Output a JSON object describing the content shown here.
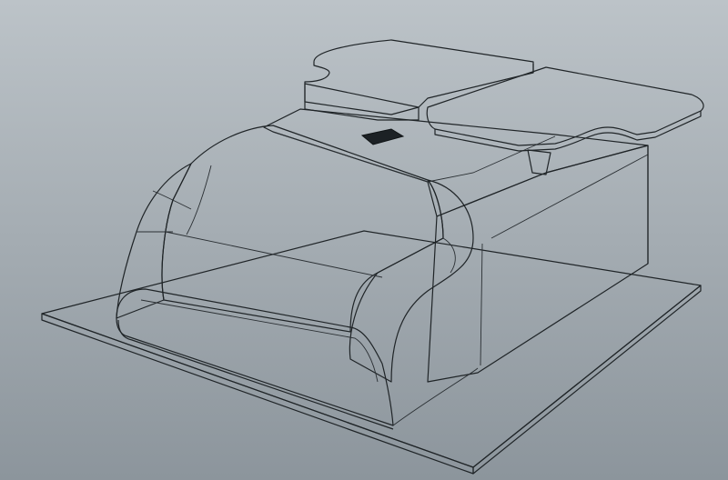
{
  "viewport": {
    "background_top": "#bcc3c8",
    "background_bottom": "#8c959c"
  },
  "model": {
    "body_color": "#4a5257",
    "base_plate_color": "#5b6368",
    "lid_color": "#9ea2a5",
    "edge_color": "#1f2427"
  }
}
